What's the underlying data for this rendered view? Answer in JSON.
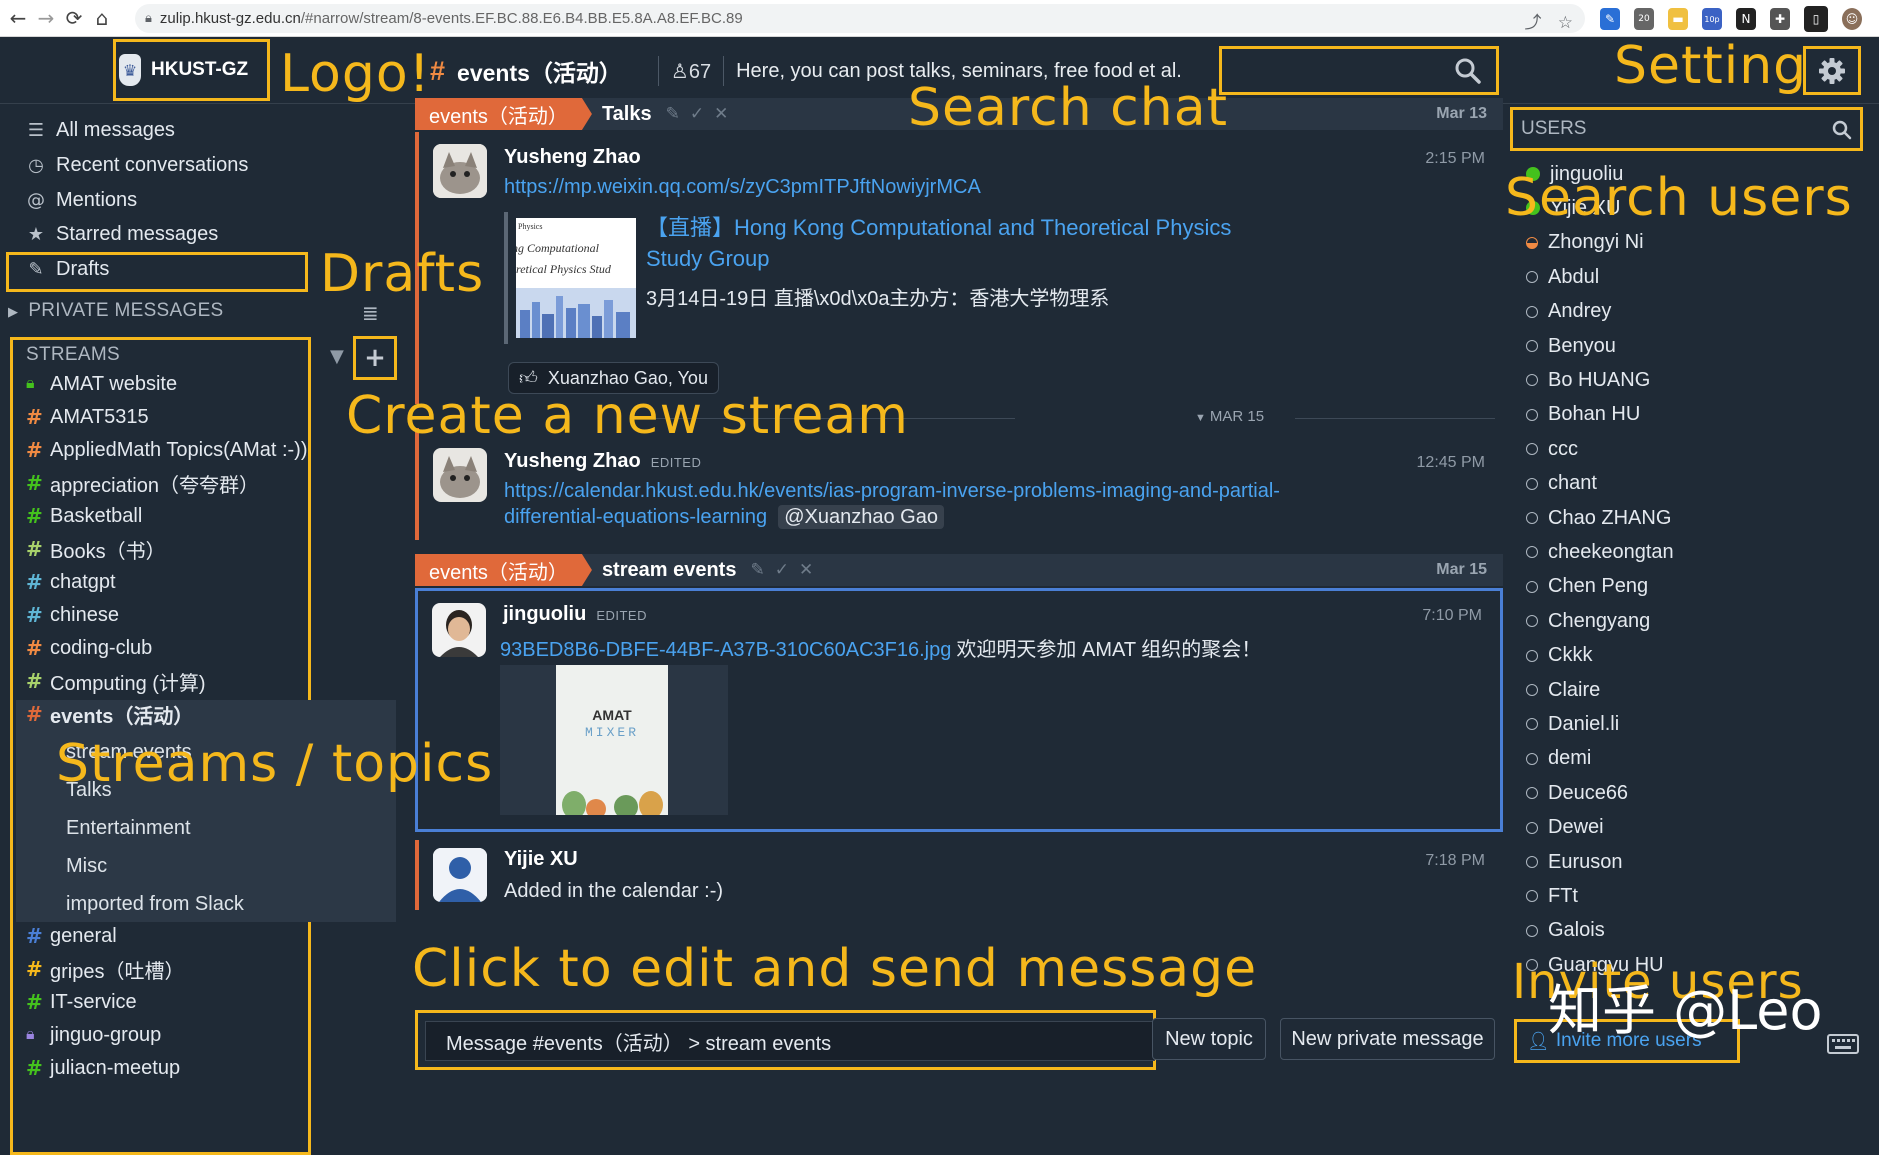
{
  "browser": {
    "url_host": "zulip.hkust-gz.edu.cn",
    "url_path": "/#narrow/stream/8-events.EF.BC.88.E6.B4.BB.E5.8A.A8.EF.BC.89",
    "badge_20": "20",
    "badge_10p": "10p"
  },
  "header": {
    "logo_text": "HKUST-GZ",
    "stream_name": "events（活动）",
    "subscriber_count": "67",
    "description": "Here, you can post talks, seminars, free food et al."
  },
  "left_nav": {
    "items": [
      {
        "label": "All messages",
        "icon": "all-messages-icon"
      },
      {
        "label": "Recent conversations",
        "icon": "clock-icon"
      },
      {
        "label": "Mentions",
        "icon": "at-icon"
      },
      {
        "label": "Starred messages",
        "icon": "star-icon"
      },
      {
        "label": "Drafts",
        "icon": "pencil-icon"
      }
    ],
    "private_messages_header": "PRIVATE MESSAGES",
    "streams_header": "STREAMS",
    "streams": [
      {
        "name": "AMAT website",
        "icon": "lock",
        "color": "#44c21d"
      },
      {
        "name": "AMAT5315",
        "icon": "hash",
        "color": "#f08a43"
      },
      {
        "name": "AppliedMath Topics(AMat :-))",
        "icon": "hash",
        "color": "#f08a43"
      },
      {
        "name": "appreciation（夸夸群）",
        "icon": "hash",
        "color": "#44c21d"
      },
      {
        "name": "Basketball",
        "icon": "hash",
        "color": "#44c21d"
      },
      {
        "name": "Books（书）",
        "icon": "hash",
        "color": "#a8d26b"
      },
      {
        "name": "chatgpt",
        "icon": "hash",
        "color": "#5fb6d6"
      },
      {
        "name": "chinese",
        "icon": "hash",
        "color": "#5fb6d6"
      },
      {
        "name": "coding-club",
        "icon": "hash",
        "color": "#f08a43"
      },
      {
        "name": "Computing (计算)",
        "icon": "hash",
        "color": "#a8d26b"
      },
      {
        "name": "events（活动）",
        "icon": "hash",
        "color": "#e0693a"
      }
    ],
    "topics": [
      "stream events",
      "Talks",
      "Entertainment",
      "Misc",
      "imported from Slack"
    ],
    "streams_after": [
      {
        "name": "general",
        "icon": "hash",
        "color": "#4a7fd6"
      },
      {
        "name": "gripes（吐槽）",
        "icon": "hash",
        "color": "#f5b81c"
      },
      {
        "name": "IT-service",
        "icon": "hash",
        "color": "#44c21d"
      },
      {
        "name": "jinguo-group",
        "icon": "lock",
        "color": "#9a84e0"
      },
      {
        "name": "juliacn-meetup",
        "icon": "hash",
        "color": "#44c21d"
      }
    ]
  },
  "feed": {
    "talks_bar": {
      "stream": "events（活动）",
      "topic": "Talks",
      "date": "Mar 13"
    },
    "msg1": {
      "sender": "Yusheng Zhao",
      "time": "2:15 PM",
      "link": "https://mp.weixin.qq.com/s/zyC3pmITPJftNowiyjrMCA",
      "preview_title_1": "【直播】Hong Kong Computational and Theoretical Physics",
      "preview_title_2": "Study Group",
      "preview_desc": "3月14日-19日 直播\\x0d\\x0a主办方：香港大学物理系",
      "thumb_text_1": "Physics",
      "thumb_text_2": "ng Computational",
      "thumb_text_3": "oretical Physics Stud",
      "reaction_users": "Xuanzhao Gao, You"
    },
    "date_divider": "MAR 15",
    "msg2": {
      "sender": "Yusheng Zhao",
      "edited": "EDITED",
      "time": "12:45 PM",
      "link_line1": "https://calendar.hkust.edu.hk/events/ias-program-inverse-problems-imaging-and-partial-",
      "link_line2": "differential-equations-learning",
      "mention": "@Xuanzhao Gao"
    },
    "events_bar": {
      "stream": "events（活动）",
      "topic": "stream events",
      "date": "Mar 15"
    },
    "msg3": {
      "sender": "jinguoliu",
      "edited": "EDITED",
      "time": "7:10 PM",
      "file_link": "93BED8B6-DBFE-44BF-A37B-310C60AC3F16.jpg",
      "text": "欢迎明天参加 AMAT 组织的聚会！",
      "poster_title_1": "AMAT",
      "poster_title_2": "MIXER"
    },
    "msg4": {
      "sender": "Yijie XU",
      "time": "7:18 PM",
      "text": "Added in the calendar :-)"
    }
  },
  "compose": {
    "placeholder": "Message #events（活动） > stream events",
    "new_topic": "New topic",
    "new_private": "New private message"
  },
  "users": {
    "search_label": "USERS",
    "list": [
      {
        "name": "jinguoliu",
        "status": "active"
      },
      {
        "name": "Yijie XU",
        "status": "active"
      },
      {
        "name": "Zhongyi Ni",
        "status": "idle"
      },
      {
        "name": "Abdul",
        "status": "offline"
      },
      {
        "name": "Andrey",
        "status": "offline"
      },
      {
        "name": "Benyou",
        "status": "offline"
      },
      {
        "name": "Bo HUANG",
        "status": "offline"
      },
      {
        "name": "Bohan HU",
        "status": "offline"
      },
      {
        "name": "ccc",
        "status": "offline"
      },
      {
        "name": "chant",
        "status": "offline"
      },
      {
        "name": "Chao ZHANG",
        "status": "offline"
      },
      {
        "name": "cheekeongtan",
        "status": "offline"
      },
      {
        "name": "Chen Peng",
        "status": "offline"
      },
      {
        "name": "Chengyang",
        "status": "offline"
      },
      {
        "name": "Ckkk",
        "status": "offline"
      },
      {
        "name": "Claire",
        "status": "offline"
      },
      {
        "name": "Daniel.li",
        "status": "offline"
      },
      {
        "name": "demi",
        "status": "offline"
      },
      {
        "name": "Deuce66",
        "status": "offline"
      },
      {
        "name": "Dewei",
        "status": "offline"
      },
      {
        "name": "Euruson",
        "status": "offline"
      },
      {
        "name": "FTt",
        "status": "offline"
      },
      {
        "name": "Galois",
        "status": "offline"
      },
      {
        "name": "Guangyu HU",
        "status": "offline"
      }
    ],
    "invite_label": "Invite more users"
  },
  "annotations": {
    "logo": "Logo!",
    "setting": "Setting",
    "search_chat": "Search chat",
    "search_users": "Search users",
    "drafts": "Drafts",
    "create_stream": "Create a new stream",
    "streams_topics": "Streams / topics",
    "click_edit": "Click to edit and send message",
    "invite_users": "Invite users",
    "watermark": "知乎 @Leo"
  },
  "colors": {
    "accent_annotation": "#f5b81c",
    "stream_events": "#e0693a",
    "link": "#4aa3f0",
    "background": "#1f2a36"
  }
}
